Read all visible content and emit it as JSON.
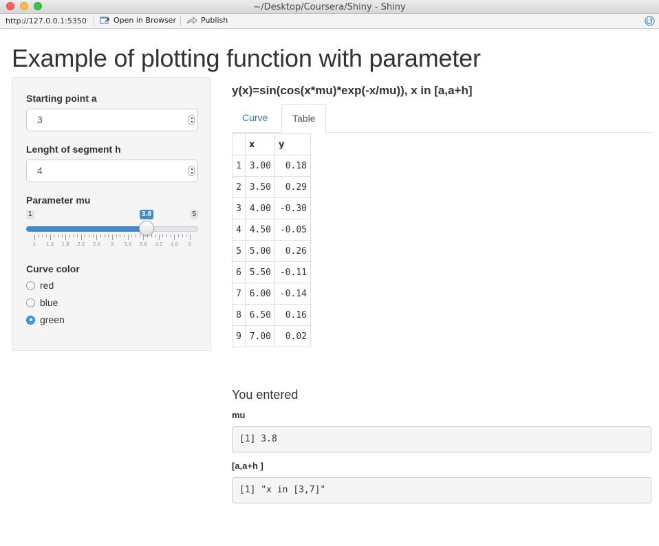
{
  "window": {
    "title": "~/Desktop/Coursera/Shiny - Shiny"
  },
  "toolbar": {
    "url": "http://127.0.0.1:5350",
    "open_label": "Open in Browser",
    "publish_label": "Publish"
  },
  "page": {
    "title": "Example of plotting function with parameter"
  },
  "sidebar": {
    "a_label": "Starting point a",
    "a_value": "3",
    "h_label": "Lenght of segment h",
    "h_value": "4",
    "mu_label": "Parameter mu",
    "mu_min": "1",
    "mu_max": "5",
    "mu_value": "3.8",
    "mu_fraction": 0.7,
    "tick_labels": [
      "1",
      "1.4",
      "1.8",
      "2.2",
      "2.6",
      "3",
      "3.4",
      "3.8",
      "4.2",
      "4.6",
      "5"
    ],
    "color_label": "Curve color",
    "colors": [
      "red",
      "blue",
      "green"
    ],
    "selected_color": "green",
    "accent_color": "#428bca"
  },
  "main": {
    "heading": "y(x)=sin(cos(x*mu)*exp(-x/mu)), x in [a,a+h]",
    "tabs": [
      "Curve",
      "Table"
    ],
    "active_tab": "Table",
    "table": {
      "columns": [
        "",
        "x",
        "y"
      ],
      "rows": [
        [
          "1",
          "3.00",
          "0.18"
        ],
        [
          "2",
          "3.50",
          "0.29"
        ],
        [
          "3",
          "4.00",
          "-0.30"
        ],
        [
          "4",
          "4.50",
          "-0.05"
        ],
        [
          "5",
          "5.00",
          "0.26"
        ],
        [
          "6",
          "5.50",
          "-0.11"
        ],
        [
          "7",
          "6.00",
          "-0.14"
        ],
        [
          "8",
          "6.50",
          "0.16"
        ],
        [
          "9",
          "7.00",
          "0.02"
        ]
      ]
    },
    "entered_heading": "You entered",
    "mu_heading": "mu",
    "mu_output": "[1] 3.8",
    "range_heading": "[a,a+h ]",
    "range_output": "[1] \"x in [3,7]\""
  }
}
